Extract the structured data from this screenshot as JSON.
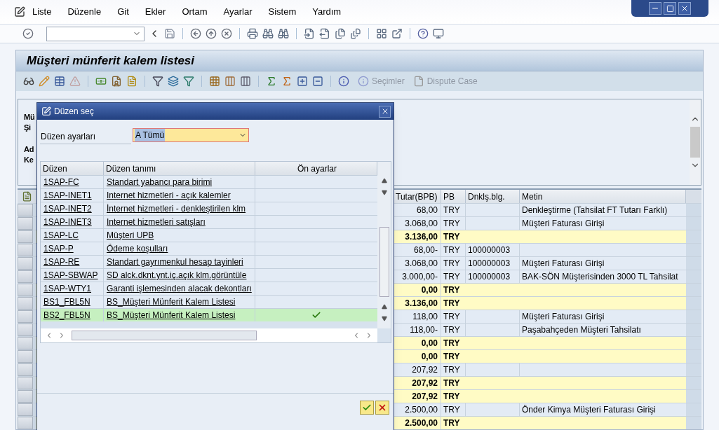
{
  "menu_bar": {
    "items": [
      "Liste",
      "Düzenle",
      "Git",
      "Ekler",
      "Ortam",
      "Ayarlar",
      "Sistem",
      "Yardım"
    ]
  },
  "app": {
    "title": "Müşteri münferit kalem listesi",
    "toolbar_buttons": [
      {
        "label": "Seçimler",
        "disabled": true
      },
      {
        "label": "Dispute Case",
        "disabled": true
      }
    ]
  },
  "header_fragments": [
    "Mü",
    "Şi",
    "Ad",
    "Ke"
  ],
  "grid": {
    "columns": [
      "Tutar(BPB)",
      "PB",
      "Dnklş.blg.",
      "Metin"
    ],
    "rows": [
      {
        "kind": "item",
        "amount": "68,00",
        "currency": "TRY",
        "text": "Denkleştirme (Tahsilat FT Tutarı Farklı)"
      },
      {
        "kind": "item",
        "amount": "3.068,00",
        "currency": "TRY",
        "text": "Müşteri Faturası Girişi"
      },
      {
        "kind": "total",
        "amount": "3.136,00",
        "currency": "TRY"
      },
      {
        "kind": "item",
        "amount": "68,00-",
        "currency": "TRY",
        "doc": "100000003"
      },
      {
        "kind": "item",
        "amount": "3.068,00",
        "currency": "TRY",
        "doc": "100000003",
        "text": "Müşteri Faturası Girişi"
      },
      {
        "kind": "item",
        "amount": "3.000,00-",
        "currency": "TRY",
        "doc": "100000003",
        "text": "BAK-SÖN Müşterisinden 3000 TL Tahsilat"
      },
      {
        "kind": "total",
        "amount": "0,00",
        "currency": "TRY"
      },
      {
        "kind": "total",
        "amount": "3.136,00",
        "currency": "TRY"
      },
      {
        "kind": "item",
        "amount": "118,00",
        "currency": "TRY",
        "text": "Müşteri Faturası Girişi"
      },
      {
        "kind": "item",
        "amount": "118,00-",
        "currency": "TRY",
        "text": "Paşabahçeden Müşteri Tahsilatı"
      },
      {
        "kind": "total",
        "amount": "0,00",
        "currency": "TRY"
      },
      {
        "kind": "total",
        "amount": "0,00",
        "currency": "TRY"
      },
      {
        "kind": "item",
        "amount": "207,92",
        "currency": "TRY"
      },
      {
        "kind": "total",
        "amount": "207,92",
        "currency": "TRY"
      },
      {
        "kind": "total",
        "amount": "207,92",
        "currency": "TRY"
      },
      {
        "kind": "item",
        "amount": "2.500,00",
        "currency": "TRY",
        "text": "Önder Kimya Müşteri Faturası Girişi"
      },
      {
        "kind": "total",
        "amount": "2.500,00",
        "currency": "TRY"
      }
    ]
  },
  "dialog": {
    "title": "Düzen seç",
    "setting_label": "Düzen ayarları",
    "setting_value": "A Tümü",
    "columns": [
      "Düzen",
      "Düzen tanımı",
      "Ön ayarlar"
    ],
    "rows": [
      {
        "layout": "1SAP-FC",
        "description": "Standart yabancı para birimi",
        "default": false,
        "selected": false
      },
      {
        "layout": "1SAP-INET1",
        "description": "Internet hizmetleri - açık kalemler",
        "default": false,
        "selected": false
      },
      {
        "layout": "1SAP-INET2",
        "description": "İnternet hizmetleri - denkleştirilen klm",
        "default": false,
        "selected": false
      },
      {
        "layout": "1SAP-INET3",
        "description": "Internet hizmetleri satışları",
        "default": false,
        "selected": false
      },
      {
        "layout": "1SAP-LC",
        "description": "Müşteri UPB",
        "default": false,
        "selected": false
      },
      {
        "layout": "1SAP-P",
        "description": "Ödeme koşulları",
        "default": false,
        "selected": false
      },
      {
        "layout": "1SAP-RE",
        "description": "Standart gayrımenkul hesap tayinleri",
        "default": false,
        "selected": false
      },
      {
        "layout": "1SAP-SBWAP",
        "description": "SD alck.dknt.ynt.iç.açık klm.görüntüle",
        "default": false,
        "selected": false
      },
      {
        "layout": "1SAP-WTY1",
        "description": "Garanti işlemesinden alacak dekontları",
        "default": false,
        "selected": false
      },
      {
        "layout": "BS1_FBL5N",
        "description": "BS_Müşteri Münferit Kalem Listesi",
        "default": false,
        "selected": false
      },
      {
        "layout": "BS2_FBL5N",
        "description": "BS_Müşteri Münferit Kalem Listesi",
        "default": true,
        "selected": true
      }
    ]
  }
}
